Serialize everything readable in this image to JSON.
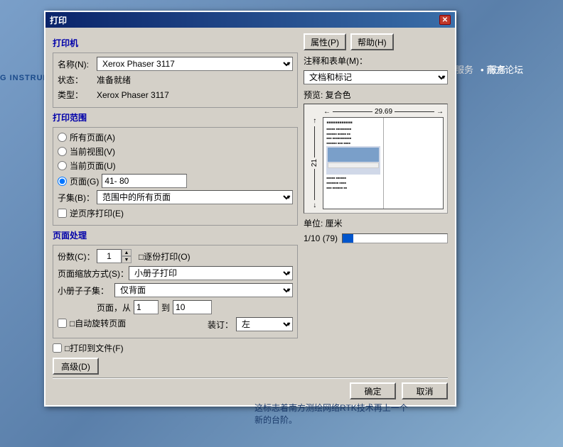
{
  "background": {
    "nav_service": "服务",
    "nav_forum": "• 南方论坛",
    "instrument_label": "G INSTRUMENT"
  },
  "dialog": {
    "title": "打印",
    "close_icon": "✕",
    "printer_section": "打印机",
    "name_label": "名称(N):",
    "printer_name": "Xerox Phaser 3117",
    "status_label": "状态：",
    "status_value": "准备就绪",
    "type_label": "类型：",
    "type_value": "Xerox Phaser 3117",
    "properties_btn": "属性(P)",
    "help_btn": "帮助(H)",
    "annotations_label": "注释和表单(M)：",
    "annotations_value": "文档和标记",
    "print_range_section": "打印范围",
    "radio_all_pages": "所有页面(A)",
    "radio_current_view": "当前视图(V)",
    "radio_current_page": "当前页面(U)",
    "radio_pages": "页面(G)",
    "pages_value": "41- 80",
    "subset_label": "子集(B)：",
    "subset_value": "范围中的所有页面",
    "reverse_order": "逆页序打印(E)",
    "page_handling_section": "页面处理",
    "copies_label": "份数(C)：",
    "copies_value": "1",
    "collate_label": "□逐份打印(O)",
    "page_scaling_label": "页面缩放方式(S)：",
    "page_scaling_value": "小册子打印",
    "booklet_subset_label": "小册子子集：",
    "booklet_subset_value": "仅背面",
    "pages_from_label": "页面，从",
    "pages_from_value": "1",
    "pages_to_label": "到",
    "pages_to_value": "10",
    "auto_rotate_label": "□自动旋转页面",
    "binding_label": "装订：",
    "binding_value": "左",
    "print_to_file": "□打印到文件(F)",
    "advanced_btn": "高级(D)",
    "ok_btn": "确定",
    "cancel_btn": "取消",
    "preview_label": "预览: 复合色",
    "preview_width": "29.69",
    "preview_height": "21",
    "unit_label": "单位: 厘米",
    "progress_label": "1/10 (79)"
  },
  "footer": {
    "text1": "这标志着南方测绘网络RTK技术再上一个",
    "text2": "新的台阶。"
  }
}
